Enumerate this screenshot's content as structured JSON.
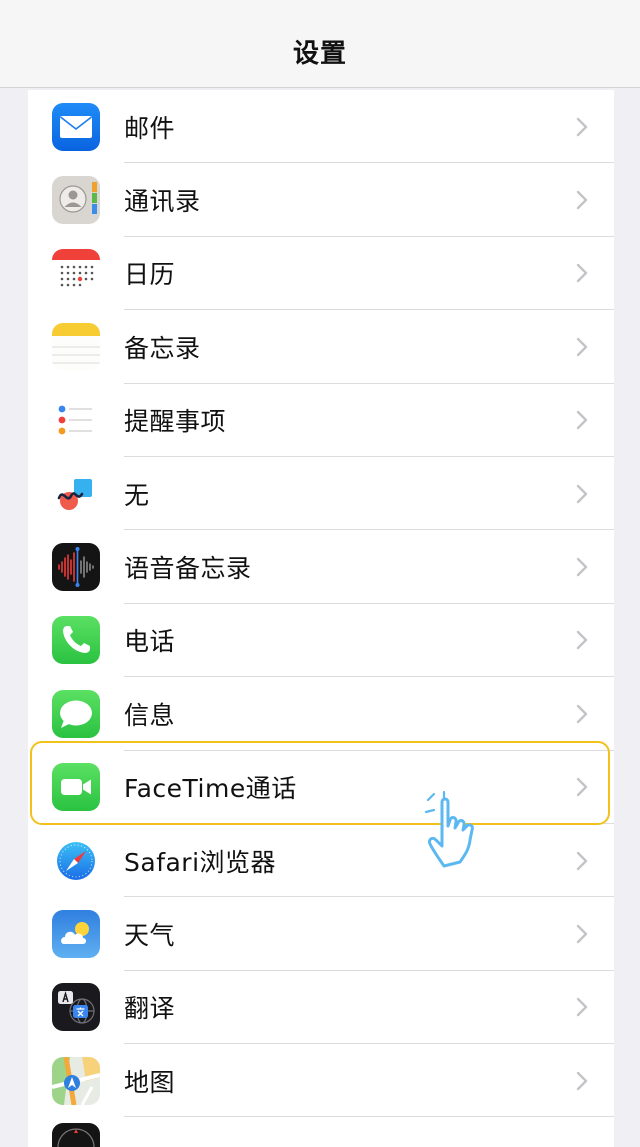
{
  "nav": {
    "title": "设置"
  },
  "rows": [
    {
      "label": "邮件",
      "icon": "mail-icon"
    },
    {
      "label": "通讯录",
      "icon": "contacts-icon"
    },
    {
      "label": "日历",
      "icon": "calendar-icon"
    },
    {
      "label": "备忘录",
      "icon": "notes-icon"
    },
    {
      "label": "提醒事项",
      "icon": "reminders-icon"
    },
    {
      "label": "无",
      "icon": "freeform-icon"
    },
    {
      "label": "语音备忘录",
      "icon": "voice-memos-icon"
    },
    {
      "label": "电话",
      "icon": "phone-icon"
    },
    {
      "label": "信息",
      "icon": "messages-icon"
    },
    {
      "label": "FaceTime通话",
      "icon": "facetime-icon",
      "highlighted": true
    },
    {
      "label": "Safari浏览器",
      "icon": "safari-icon"
    },
    {
      "label": "天气",
      "icon": "weather-icon"
    },
    {
      "label": "翻译",
      "icon": "translate-icon"
    },
    {
      "label": "地图",
      "icon": "maps-icon"
    }
  ],
  "colors": {
    "highlight_border": "#f2c21b",
    "pointer_hand": "#5bb8f0"
  }
}
